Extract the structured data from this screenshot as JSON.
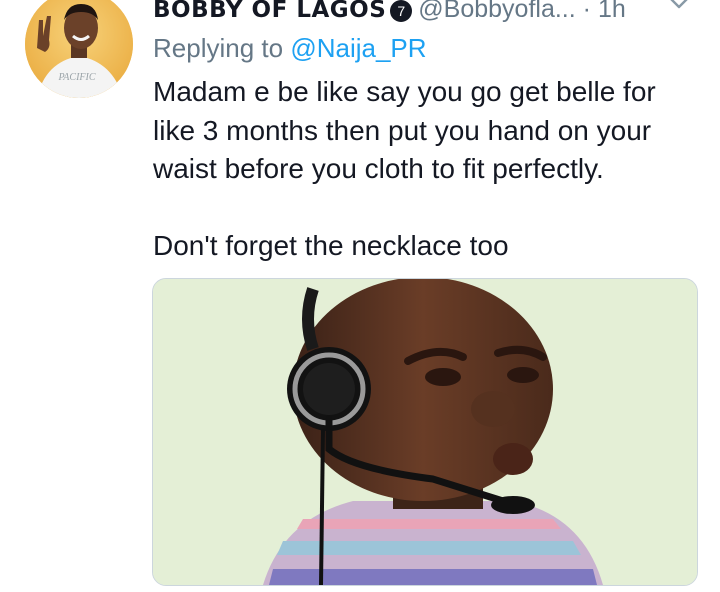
{
  "tweet": {
    "display_name": "BOBBY OF LAGOS",
    "verified_glyph": "7",
    "handle": "@Bobbyofla...",
    "separator": "·",
    "timestamp": "1h",
    "replying_prefix": "Replying to ",
    "replying_to": "@Naija_PR",
    "text_paragraph_1": "Madam e be like say you go get belle for like 3 months then put you hand on your waist before you cloth to fit perfectly.",
    "text_paragraph_2": "Don't forget the necklace too",
    "avatar_shirt_text": "PACIFIC"
  },
  "icons": {
    "avatar": "user-avatar",
    "verified": "verified-badge-icon",
    "caret": "chevron-down-icon"
  },
  "colors": {
    "text_primary": "#141823",
    "text_secondary": "#657786",
    "link": "#1da1f2",
    "media_background": "#e7f1d9"
  }
}
